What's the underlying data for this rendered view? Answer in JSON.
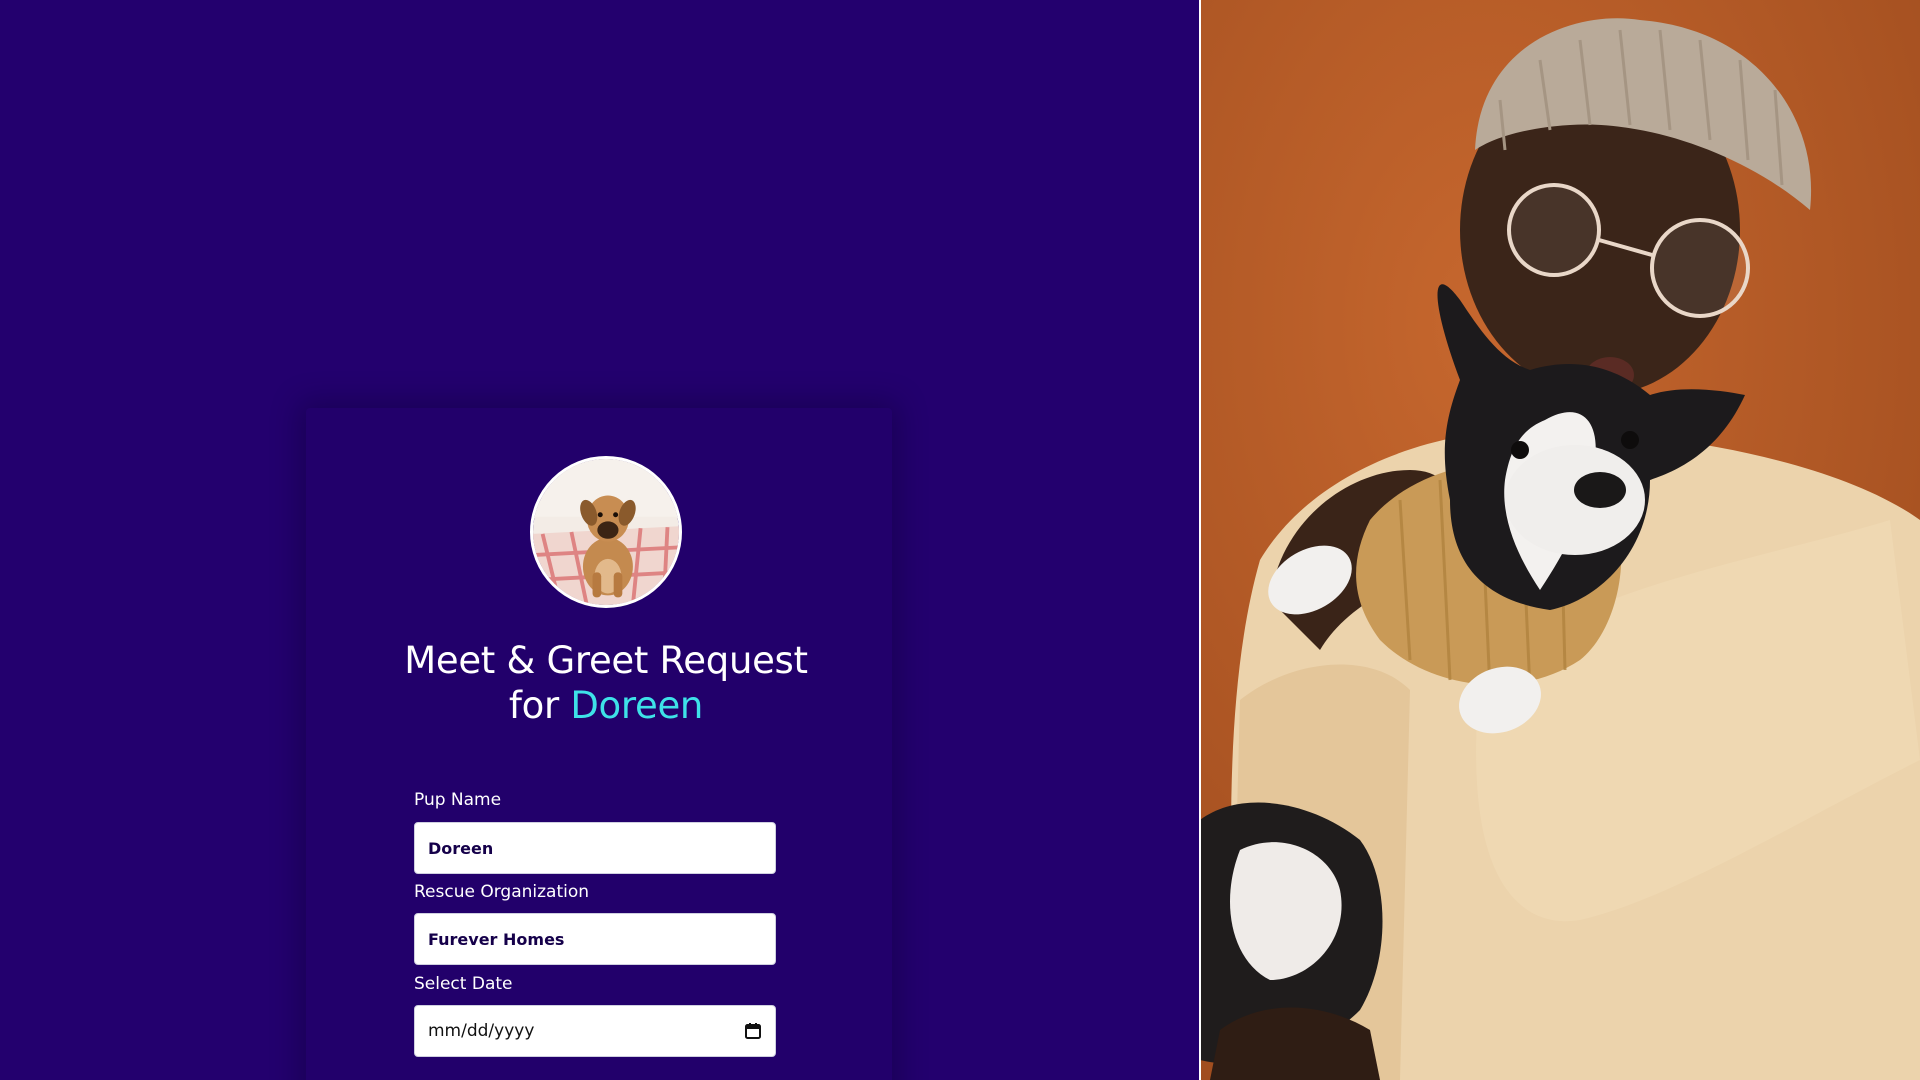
{
  "card": {
    "title_line1": "Meet & Greet Request",
    "title_prefix": "for",
    "title_pup": "Doreen",
    "avatar_alt": "puppy-photo"
  },
  "form": {
    "pup_name": {
      "label": "Pup Name",
      "value": "Doreen"
    },
    "rescue_org": {
      "label": "Rescue Organization",
      "value": "Furever Homes"
    },
    "date": {
      "label": "Select Date",
      "placeholder": "mm/dd/yyyy"
    }
  },
  "colors": {
    "background": "#22006d",
    "accent": "#3ee2e8",
    "text": "#ffffff"
  },
  "icons": {
    "calendar": "calendar-icon"
  }
}
